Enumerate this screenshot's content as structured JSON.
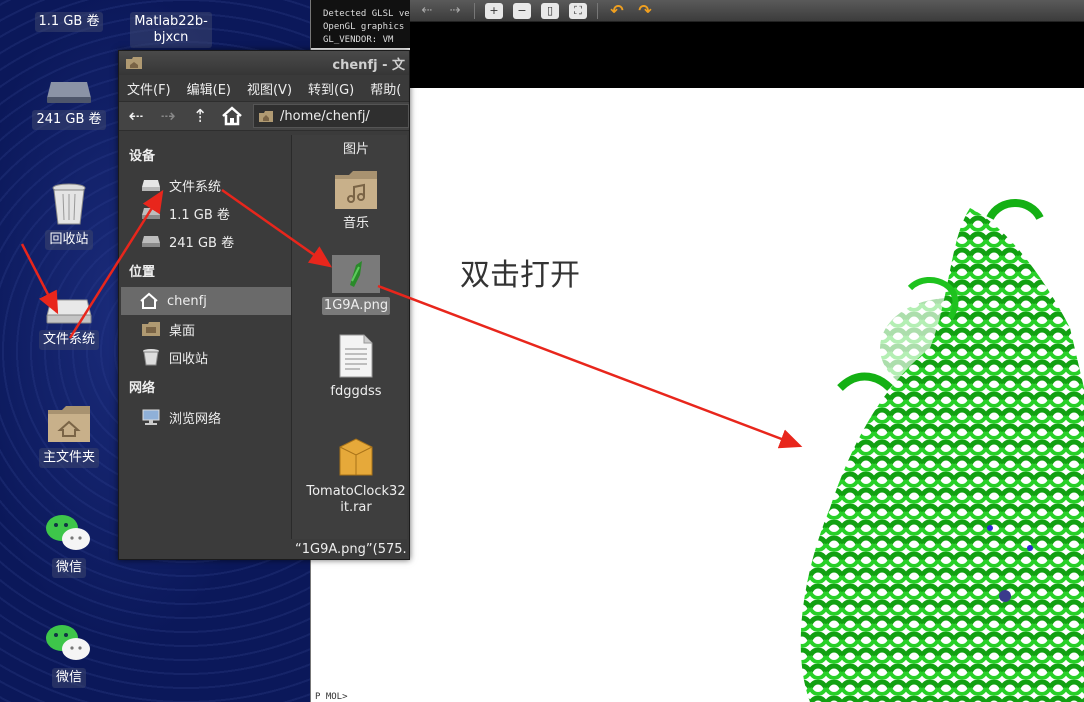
{
  "desktop": {
    "icons": [
      {
        "label": "1.1 GB 卷",
        "icon": "drive-icon"
      },
      {
        "label": "Matlab22b-\nbjxcn",
        "icon": "folder-icon"
      },
      {
        "label": "241 GB 卷",
        "icon": "drive-icon"
      },
      {
        "label": "回收站",
        "icon": "trash-icon"
      },
      {
        "label": "文件系统",
        "icon": "drive-icon"
      },
      {
        "label": "主文件夹",
        "icon": "home-folder-icon"
      },
      {
        "label": "微信",
        "icon": "wechat-icon"
      },
      {
        "label": "微信",
        "icon": "wechat-icon"
      }
    ]
  },
  "terminal": {
    "lines": [
      "Detected GLSL ve",
      "OpenGL graphics e",
      " GL_VENDOR:  VM"
    ],
    "footer": "P  MOL>"
  },
  "file_manager": {
    "title": "chenfj - 文",
    "menu": [
      "文件(F)",
      "编辑(E)",
      "视图(V)",
      "转到(G)",
      "帮助("
    ],
    "path": "/home/chenfj/",
    "sidebar": {
      "devices_header": "设备",
      "devices": [
        "文件系统",
        "1.1 GB 卷",
        "241 GB 卷"
      ],
      "places_header": "位置",
      "places": [
        "chenfj",
        "桌面",
        "回收站"
      ],
      "network_header": "网络",
      "network": [
        "浏览网络"
      ]
    },
    "files": [
      {
        "label": "图片",
        "icon": "pictures-folder-icon"
      },
      {
        "label": "音乐",
        "icon": "music-folder-icon"
      },
      {
        "label": "1G9A.png",
        "icon": "image-file-icon",
        "selected": true
      },
      {
        "label": "fdggdss",
        "icon": "text-file-icon"
      },
      {
        "label": "TomatoClock32\nit.rar",
        "icon": "archive-icon"
      }
    ],
    "status": "“1G9A.png”(575."
  },
  "viewer": {
    "instruction": "双击打开"
  },
  "colors": {
    "desktop_bg": "#0b185a",
    "window_bg": "#3b3b3b",
    "arrow": "#e8261c",
    "protein": "#1fc21f"
  }
}
